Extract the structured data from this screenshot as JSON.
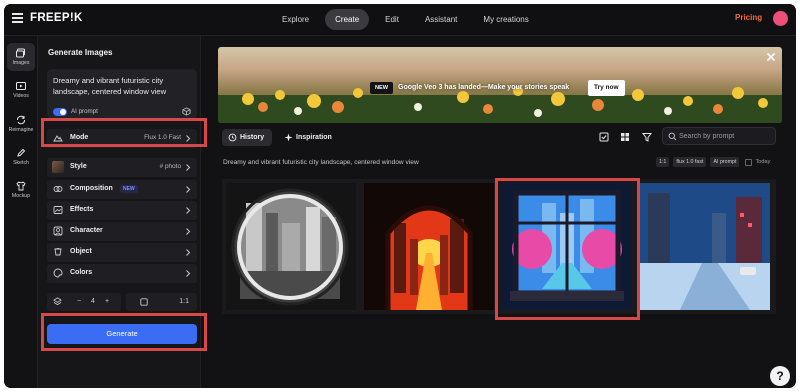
{
  "app": {
    "logo": "FREEP!K"
  },
  "nav": {
    "items": [
      "Explore",
      "Create",
      "Edit",
      "Assistant",
      "My creations"
    ],
    "active": "Create"
  },
  "header": {
    "pricing": "Pricing"
  },
  "rail": {
    "items": [
      "Images",
      "Videos",
      "Reimagine",
      "Sketch",
      "Mockup"
    ],
    "active": "Images"
  },
  "panel": {
    "title": "Generate Images",
    "prompt": "Dreamy and vibrant futuristic city landscape, centered window view",
    "ai_prompt_label": "AI prompt",
    "mode": {
      "label": "Mode",
      "value": "Flux 1.0 Fast"
    },
    "style": {
      "label": "Style",
      "value": "# photo"
    },
    "composition": {
      "label": "Composition",
      "badge": "NEW"
    },
    "effects": {
      "label": "Effects"
    },
    "character": {
      "label": "Character"
    },
    "object": {
      "label": "Object"
    },
    "colors": {
      "label": "Colors"
    },
    "count": {
      "minus": "−",
      "value": "4",
      "plus": "+"
    },
    "ratio": "1:1",
    "generate_label": "Generate"
  },
  "banner": {
    "badge": "NEW",
    "text": "Google Veo 3 has landed—Make your",
    "text_bold": "stories speak",
    "cta": "Try now"
  },
  "tabs": {
    "history": "History",
    "inspiration": "Inspiration"
  },
  "search": {
    "placeholder": "Search by prompt"
  },
  "results": {
    "prompt": "Dreamy and vibrant futuristic city landscape, centered window view",
    "tags": [
      "1:1",
      "flux 1.0 fast",
      "AI prompt"
    ],
    "today_label": "Today"
  },
  "help": "?",
  "colors": {
    "accent": "#3a6cf4",
    "brand": "#f26b3a",
    "highlight": "#d94848"
  }
}
